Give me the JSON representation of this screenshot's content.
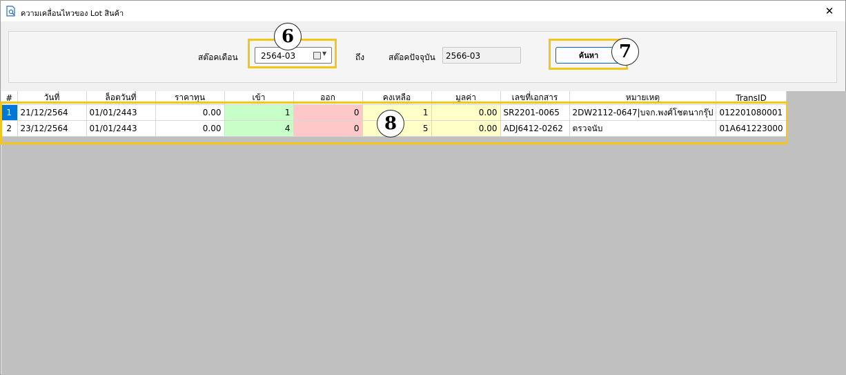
{
  "window": {
    "title": "ความเคลื่อนไหวของ Lot สินค้า",
    "close_glyph": "✕"
  },
  "filter": {
    "from_label": "สต๊อคเดือน",
    "from_value": "2564-03",
    "to_label": "ถึง",
    "current_label": "สต๊อคปัจจุบัน",
    "current_value": "2566-03",
    "search_label": "ค้นหา"
  },
  "table": {
    "columns": [
      "#",
      "วันที่",
      "ล็อตวันที่",
      "ราคาทุน",
      "เข้า",
      "ออก",
      "คงเหลือ",
      "มูลค่า",
      "เลขที่เอกสาร",
      "หมายเหตุ",
      "TransID"
    ],
    "rows": [
      [
        "1",
        "21/12/2564",
        "01/01/2443",
        "0.00",
        "1",
        "0",
        "1",
        "0.00",
        "SR2201-0065",
        "2DW2112-0647|บจก.พงศ์โชตนากรุ๊ป",
        "012201080001"
      ],
      [
        "2",
        "23/12/2564",
        "01/01/2443",
        "0.00",
        "4",
        "0",
        "5",
        "0.00",
        "ADJ6412-0262",
        "ตรวจนับ",
        "01A641223000"
      ]
    ]
  },
  "annotations": {
    "b6": "6",
    "b7": "7",
    "b8": "8"
  },
  "colors": {
    "accent": "#0078d7",
    "in_cell": "#c8ffc8",
    "out_cell": "#ffc8c8",
    "balance_cell": "#ffffc8",
    "highlight": "#f5c518",
    "grid_background": "#c0c0c0"
  },
  "icons": {
    "title": "document-search-icon",
    "calendar": "calendar-icon",
    "dropdown": "chevron-down-icon",
    "close": "close-icon"
  }
}
